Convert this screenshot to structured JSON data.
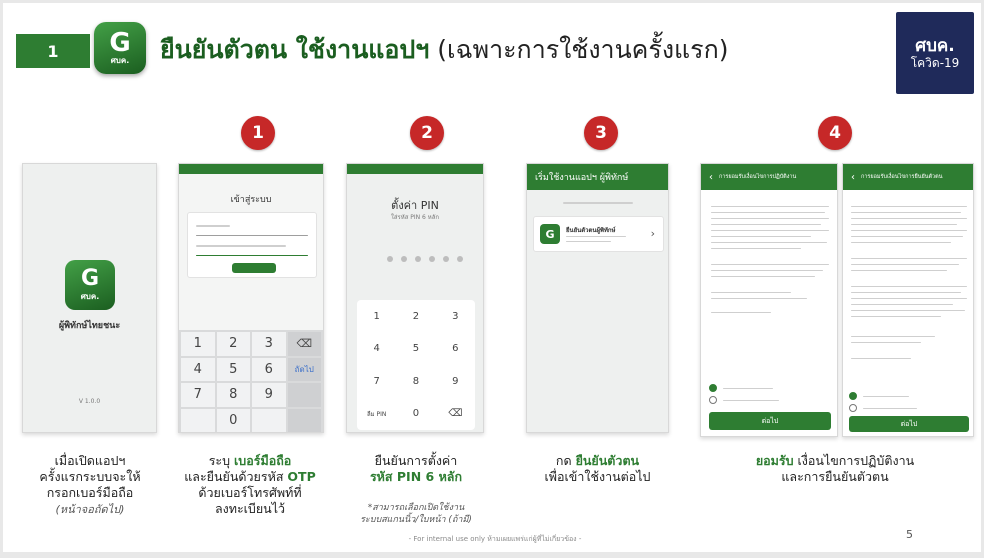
{
  "header": {
    "step_number": "1",
    "app_icon_letter": "G",
    "app_icon_text": "ศบค.",
    "title_bold": "ยืนยันตัวตน ใช้งานแอปฯ",
    "title_sub": "(เฉพาะการใช้งานครั้งแรก)"
  },
  "logo": {
    "line1": "ศบค.",
    "line2": "โควิด-19"
  },
  "steps": [
    "1",
    "2",
    "3",
    "4"
  ],
  "phone0": {
    "app_name": "ผู้พิทักษ์ไทยชนะ",
    "version": "V 1.0.0"
  },
  "phone1": {
    "title": "เข้าสู่ระบบ",
    "keys": [
      "1",
      "2",
      "3",
      "⌫",
      "4",
      "5",
      "6",
      "ถัดไป",
      "7",
      "8",
      "9",
      "",
      "",
      "0",
      "",
      ""
    ]
  },
  "phone2": {
    "title": "ตั้งค่า PIN",
    "subtitle": "ใส่รหัส PIN 6 หลัก",
    "keys": [
      "1",
      "2",
      "3",
      "4",
      "5",
      "6",
      "7",
      "8",
      "9",
      "ลืม PIN",
      "0",
      "⌫"
    ]
  },
  "phone3": {
    "header": "เริ่มใช้งานแอปฯ ผู้พิทักษ์",
    "item": "ยืนยันตัวตนผู้พิทักษ์"
  },
  "phone4": {
    "header": "การยอมรับเงื่อนไขการปฏิบัติงาน",
    "button": "ต่อไป"
  },
  "phone5": {
    "header": "การยอมรับเงื่อนไขการยืนยันตัวตน",
    "button": "ต่อไป"
  },
  "captions": {
    "c0": [
      "เมื่อเปิดแอปฯ",
      "ครั้งแรกระบบจะให้",
      "กรอกเบอร์มือถือ"
    ],
    "c0_note": "(หน้าจอถัดไป)",
    "c1_pre": "ระบุ ",
    "c1_bold": "เบอร์มือถือ",
    "c1_line2_pre": "และยืนยันด้วยรหัส ",
    "c1_line2_bold": "OTP",
    "c1_line3": "ด้วยเบอร์โทรศัพท์ที่",
    "c1_line4": "ลงทะเบียนไว้",
    "c2_line1": "ยืนยันการตั้งค่า",
    "c2_bold": "รหัส PIN 6 หลัก",
    "c2_note1": "*สามารถเลือกเปิดใช้งาน",
    "c2_note2": "ระบบสแกนนิ้ว/ใบหน้า (ถ้ามี)",
    "c3_pre": "กด ",
    "c3_bold": "ยืนยันตัวตน",
    "c3_line2": "เพื่อเข้าใช้งานต่อไป",
    "c4_bold": "ยอมรับ",
    "c4_rest": " เงื่อนไขการปฏิบัติงาน",
    "c4_line2": "และการยืนยันตัวตน"
  },
  "footer": "- For internal use only ห้ามเผยแพร่แก่ผู้ที่ไม่เกี่ยวข้อง -",
  "page_number": "5",
  "colors": {
    "green": "#2e7d32",
    "red": "#c62828",
    "logo_navy": "#1f2a5a"
  }
}
